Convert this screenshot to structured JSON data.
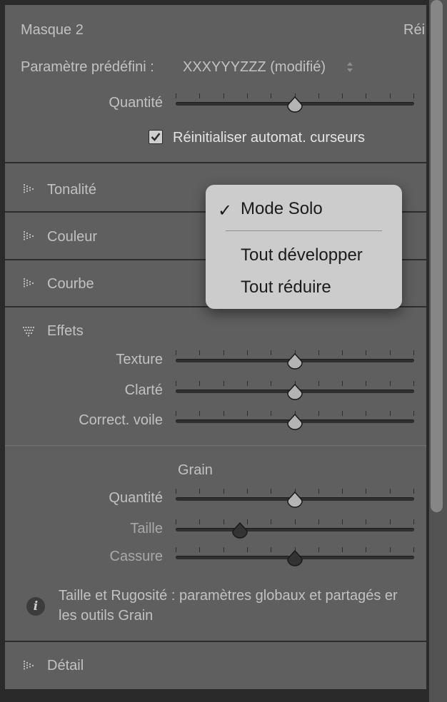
{
  "mask": {
    "title": "Masque 2",
    "reset_label": "Réi"
  },
  "preset": {
    "label": "Paramètre prédéfini :",
    "value": "XXXYYYZZZ (modifié)"
  },
  "amount": {
    "label": "Quantité",
    "value": 0.5
  },
  "auto_reset": {
    "label": "Réinitialiser automat. curseurs",
    "checked": true
  },
  "sections": {
    "tonalite": "Tonalité",
    "couleur": "Couleur",
    "courbe": "Courbe",
    "effets": "Effets",
    "detail": "Détail"
  },
  "effects": {
    "texture": {
      "label": "Texture",
      "value": 0.5
    },
    "clarte": {
      "label": "Clarté",
      "value": 0.5
    },
    "voile": {
      "label": "Correct. voile",
      "value": 0.5
    }
  },
  "grain": {
    "heading": "Grain",
    "quantite": {
      "label": "Quantité",
      "value": 0.5
    },
    "taille": {
      "label": "Taille",
      "value": 0.27
    },
    "cassure": {
      "label": "Cassure",
      "value": 0.5
    },
    "note_line1": "Taille et Rugosité : paramètres globaux et partagés er",
    "note_line2": "les outils Grain"
  },
  "context_menu": {
    "solo": {
      "label": "Mode Solo",
      "checked": true
    },
    "expand_all": "Tout développer",
    "collapse_all": "Tout réduire"
  }
}
